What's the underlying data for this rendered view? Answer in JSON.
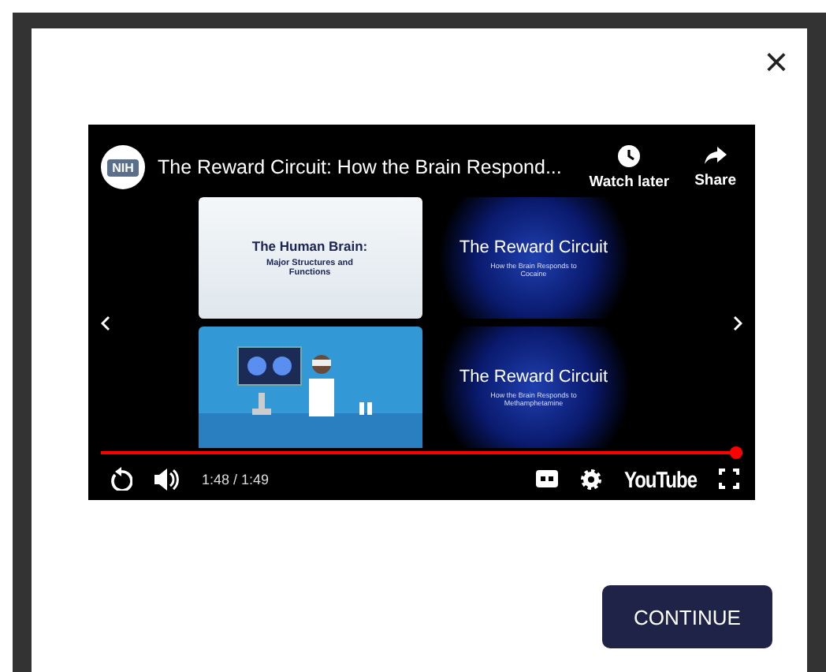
{
  "modal": {
    "close": "×",
    "button": "CONTINUE"
  },
  "video": {
    "title": "The Reward Circuit: How the Brain Respond...",
    "channel_logo": "NIH",
    "actions": [
      {
        "kind": "clock",
        "label": "Watch later"
      },
      {
        "kind": "share",
        "label": "Share"
      }
    ],
    "suggestions": [
      {
        "kind": "light",
        "title": "The Human Brain:",
        "subtitle": "Major Structures and Functions"
      },
      {
        "kind": "dark",
        "title": "The Reward Circuit",
        "subtitle": "How the Brain Responds to Cocaine"
      },
      {
        "kind": "illustration"
      },
      {
        "kind": "dark",
        "title": "The Reward Circuit",
        "subtitle": "How the Brain Responds to Methamphetamine"
      }
    ],
    "progress": {
      "level": 0.99
    },
    "time": "1:48 / 1:49",
    "brand": "YouTube"
  }
}
